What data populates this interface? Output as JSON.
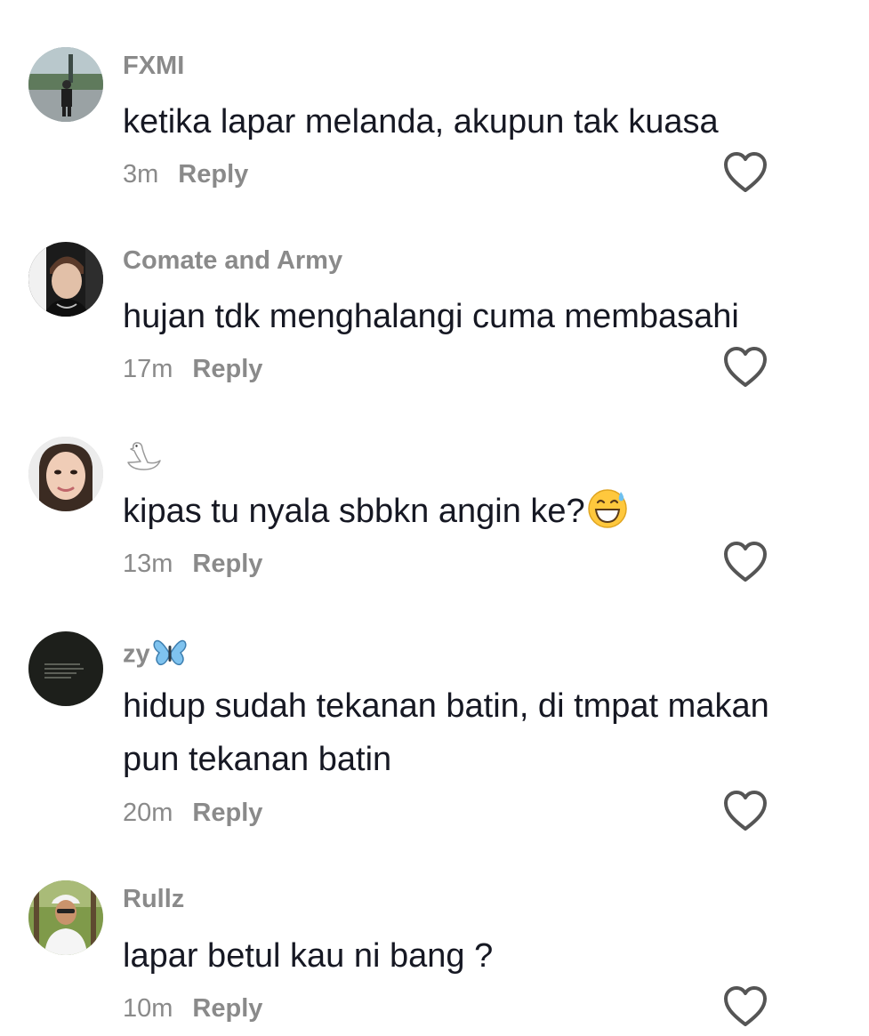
{
  "comments": [
    {
      "username": "FXMI",
      "text": "ketika lapar melanda, akupun tak kuasa",
      "time": "3m",
      "reply_label": "Reply",
      "avatar_icon": "avatar-photo-person-standing"
    },
    {
      "username": "Comate and Army",
      "text": "hujan tdk menghalangi cuma membasahi",
      "time": "17m",
      "reply_label": "Reply",
      "avatar_icon": "avatar-photo-man-portrait"
    },
    {
      "username": "",
      "username_emoji": "swan-emoji",
      "text": "kipas tu nyala sbbkn angin ke?",
      "text_emoji": "grinning-sweat-emoji",
      "time": "13m",
      "reply_label": "Reply",
      "avatar_icon": "avatar-photo-woman-face"
    },
    {
      "username": "zy",
      "username_emoji": "butterfly-emoji",
      "text": "hidup sudah tekanan batin, di tmpat makan pun tekanan batin",
      "time": "20m",
      "reply_label": "Reply",
      "avatar_icon": "avatar-dark-text-image"
    },
    {
      "username": "Rullz",
      "text": "lapar betul kau ni bang ?",
      "time": "10m",
      "reply_label": "Reply",
      "avatar_icon": "avatar-photo-man-cap"
    }
  ],
  "colors": {
    "username": "#8a8a8a",
    "text": "#161823",
    "meta": "#8a8a8a",
    "icon": "#555555"
  },
  "icons": {
    "like": "heart-outline-icon"
  }
}
